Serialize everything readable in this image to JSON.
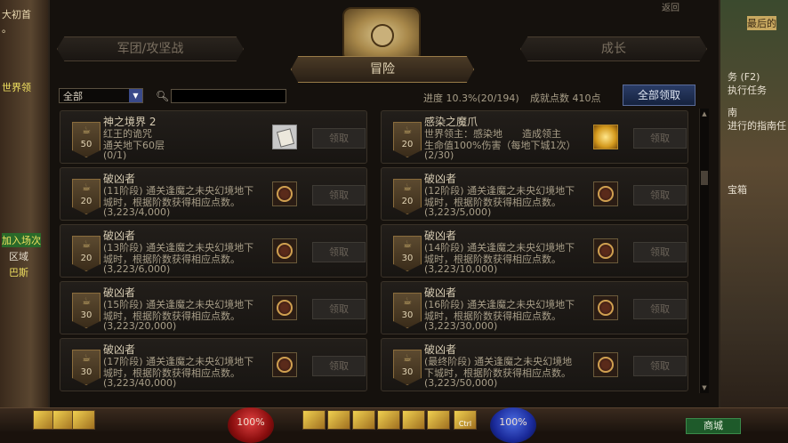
{
  "left_side": {
    "lines": [
      "大初首",
      "。",
      "世界领",
      "加入场次",
      "区域",
      "巴斯"
    ]
  },
  "right_side": {
    "banner": "最后的",
    "task_title": "务 (F2)",
    "task_sub": "执行任务",
    "guide_title": "南",
    "guide_sub": "进行的指南任",
    "box": "宝箱"
  },
  "top_right_back": "返回",
  "tabs": {
    "left": "军团/攻坚战",
    "center": "冒险",
    "right": "成长"
  },
  "filter": {
    "value": "全部",
    "search_value": ""
  },
  "progress": {
    "label": "进度 10.3%(20/194)",
    "points": "成就点数 410点"
  },
  "claim_all": "全部领取",
  "claim_label": "领取",
  "cards": [
    {
      "badge": "50",
      "title": "神之境界 2",
      "l1": "红王的诡咒",
      "l2": "通关地下60层",
      "l3": "(0/1)",
      "icon": "scroll"
    },
    {
      "badge": "20",
      "title": "感染之魔爪",
      "l1": "世界领主：感染地　　造成领主",
      "l2": "生命值100%伤害（每地下城1次）",
      "l3": "(2/30)",
      "icon": "gold"
    },
    {
      "badge": "20",
      "title": "破凶者",
      "l1": "(11阶段) 通关逢魔之未央幻境地下",
      "l2": "城时，根据阶数获得相应点数。",
      "l3": "(3,223/4,000)",
      "icon": "emblem"
    },
    {
      "badge": "20",
      "title": "破凶者",
      "l1": "(12阶段) 通关逢魔之未央幻境地下",
      "l2": "城时，根据阶数获得相应点数。",
      "l3": "(3,223/5,000)",
      "icon": "emblem"
    },
    {
      "badge": "20",
      "title": "破凶者",
      "l1": "(13阶段) 通关逢魔之未央幻境地下",
      "l2": "城时，根据阶数获得相应点数。",
      "l3": "(3,223/6,000)",
      "icon": "emblem"
    },
    {
      "badge": "30",
      "title": "破凶者",
      "l1": "(14阶段) 通关逢魔之未央幻境地下",
      "l2": "城时，根据阶数获得相应点数。",
      "l3": "(3,223/10,000)",
      "icon": "emblem"
    },
    {
      "badge": "30",
      "title": "破凶者",
      "l1": "(15阶段) 通关逢魔之未央幻境地下",
      "l2": "城时，根据阶数获得相应点数。",
      "l3": "(3,223/20,000)",
      "icon": "emblem"
    },
    {
      "badge": "30",
      "title": "破凶者",
      "l1": "(16阶段) 通关逢魔之未央幻境地下",
      "l2": "城时，根据阶数获得相应点数。",
      "l3": "(3,223/30,000)",
      "icon": "emblem"
    },
    {
      "badge": "30",
      "title": "破凶者",
      "l1": "(17阶段) 通关逢魔之未央幻境地下",
      "l2": "城时，根据阶数获得相应点数。",
      "l3": "(3,223/40,000)",
      "icon": "emblem"
    },
    {
      "badge": "30",
      "title": "破凶者",
      "l1": "(最终阶段) 通关逢魔之未央幻境地",
      "l2": "下城时，根据阶数获得相应点数。",
      "l3": "(3,223/50,000)",
      "icon": "emblem"
    }
  ],
  "bottom": {
    "hp": "100%",
    "mp": "100%",
    "shop": "商城",
    "skill_key": "Ctrl"
  },
  "colors": {
    "accent_gold": "#9a7c48",
    "claim_all_bg": "#2a3c66",
    "hp": "#e04040",
    "mp": "#4a6ae0"
  }
}
